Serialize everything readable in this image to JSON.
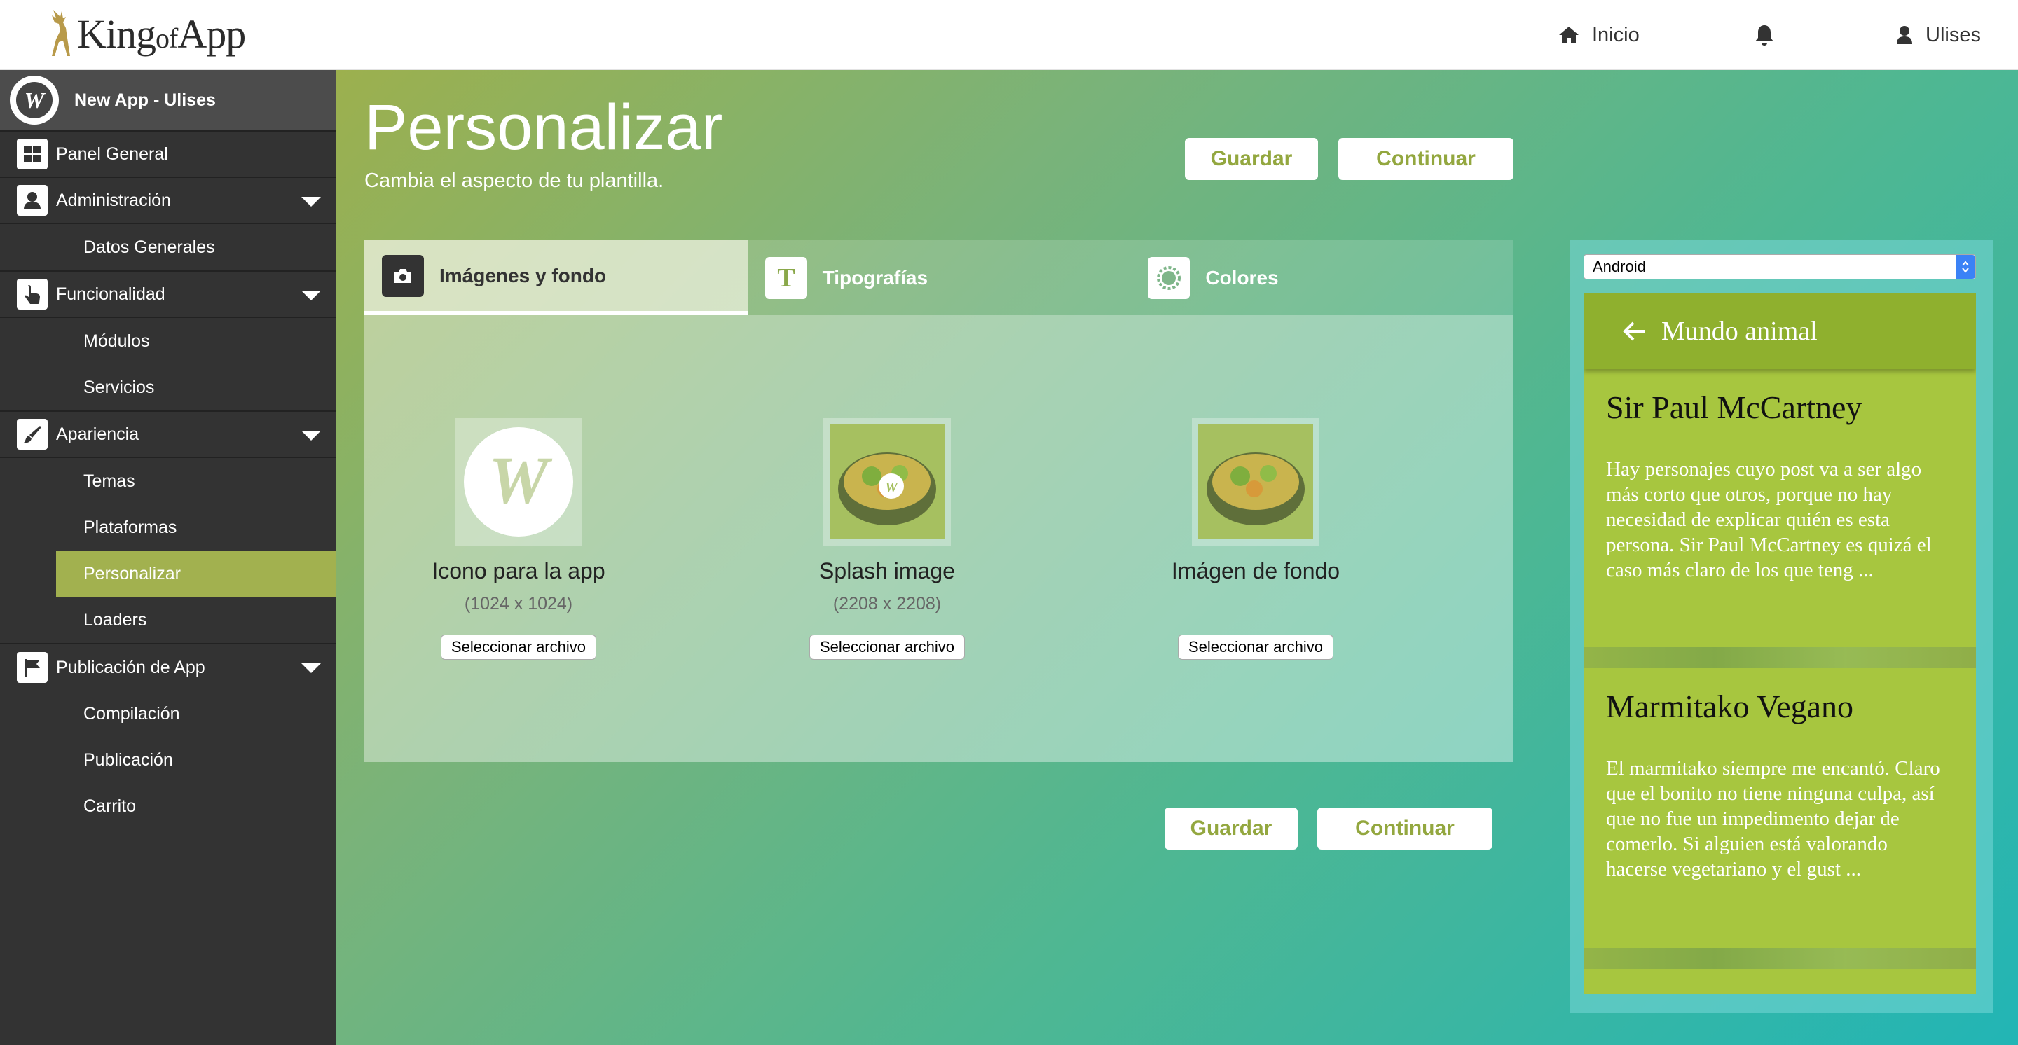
{
  "brand": {
    "logo_main": "King",
    "logo_of": "of",
    "logo_app": "App"
  },
  "topnav": {
    "home_label": "Inicio",
    "user_label": "Ulises"
  },
  "sidebar": {
    "app_name": "New App - Ulises",
    "panel_general": "Panel General",
    "administracion": "Administración",
    "datos_generales": "Datos Generales",
    "funcionalidad": "Funcionalidad",
    "modulos": "Módulos",
    "servicios": "Servicios",
    "apariencia": "Apariencia",
    "temas": "Temas",
    "plataformas": "Plataformas",
    "personalizar": "Personalizar",
    "loaders": "Loaders",
    "publicacion_app": "Publicación de App",
    "compilacion": "Compilación",
    "publicacion": "Publicación",
    "carrito": "Carrito"
  },
  "page": {
    "title": "Personalizar",
    "subtitle": "Cambia el aspecto de tu plantilla.",
    "save_label": "Guardar",
    "continue_label": "Continuar"
  },
  "tabs": {
    "images": "Imágenes y fondo",
    "fonts": "Tipografías",
    "colors": "Colores"
  },
  "uploads": {
    "icon_title": "Icono para la app",
    "icon_dim": "(1024 x 1024)",
    "splash_title": "Splash image",
    "splash_dim": "(2208 x 2208)",
    "bg_title": "Imágen de fondo",
    "file_button": "Seleccionar archivo"
  },
  "preview": {
    "platform": "Android",
    "app_bar_title": "Mundo animal",
    "posts": [
      {
        "title": "Sir Paul McCartney",
        "excerpt": "Hay personajes cuyo post va a ser algo más corto que otros, porque no hay necesidad de explicar quién es esta persona. Sir Paul McCartney es quizá el caso más claro de los que teng ..."
      },
      {
        "title": "Marmitako Vegano",
        "excerpt": "El marmitako siempre me encantó. Claro que el bonito no tiene ninguna culpa, así que no fue un impedimento dejar de comerlo. Si alguien está valorando hacerse vegetariano y el gust ..."
      }
    ]
  },
  "colors": {
    "accent": "#a2b14f",
    "sidebar_bg": "#333333",
    "phone_bg": "#a7c63f",
    "phone_bar": "#8fb02e"
  }
}
